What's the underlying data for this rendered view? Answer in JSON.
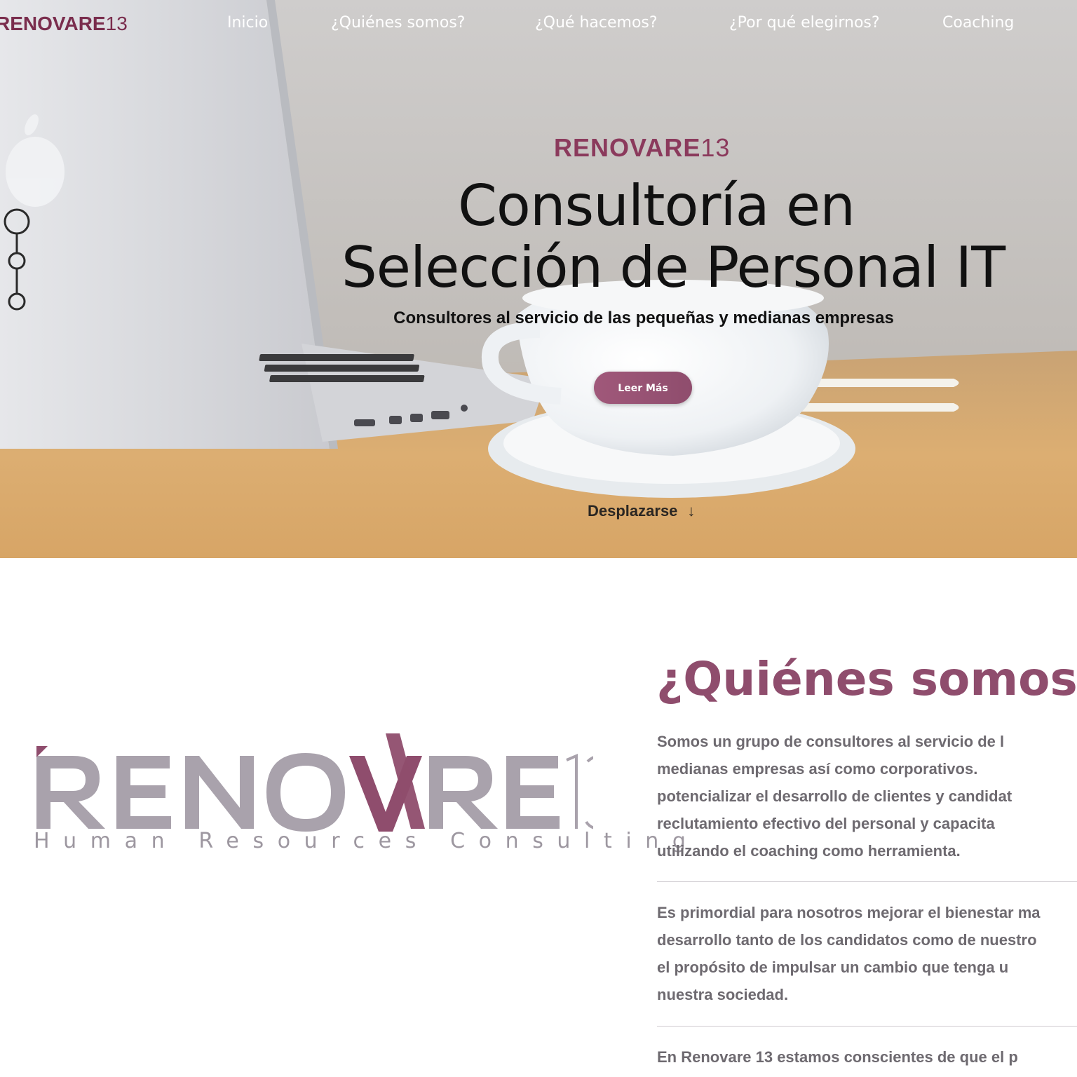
{
  "brand": {
    "word": "RENOVARE",
    "number": "13",
    "tagline": "Human Resources Consulting"
  },
  "nav": {
    "items": [
      {
        "label": "Inicio"
      },
      {
        "label": "¿Quiénes somos?"
      },
      {
        "label": "¿Qué hacemos?"
      },
      {
        "label": "¿Por qué elegirnos?"
      },
      {
        "label": "Coaching"
      }
    ]
  },
  "hero": {
    "title_line1": "Consultoría en",
    "title_line2": "Selección de Personal IT",
    "subtitle": "Consultores al servicio de las pequeñas y medianas empresas",
    "button_label": "Leer Más",
    "scroll_label": "Desplazarse",
    "scroll_arrow": "↓",
    "slide_count": 3,
    "active_slide": 1
  },
  "about": {
    "title": "¿Quiénes somos",
    "paragraph1_lines": [
      "Somos un grupo de consultores al servicio de l",
      "medianas empresas así como corporativos.",
      "potencializar el desarrollo de clientes y candidat",
      "reclutamiento efectivo del personal y capacita",
      "utilizando el coaching como herramienta."
    ],
    "paragraph2_lines": [
      "Es primordial para nosotros mejorar el bienestar ma",
      "desarrollo tanto de los candidatos como de nuestro",
      "el propósito de impulsar un cambio que tenga u",
      "nuestra sociedad."
    ],
    "paragraph3_lines": [
      "En Renovare 13 estamos conscientes de que el p"
    ]
  },
  "colors": {
    "brand_primary": "#8f4d6d",
    "brand_gray": "#a9a2ac",
    "body_text": "#6e6a70"
  },
  "icons": {
    "slide_dots": "slider-dots-icon",
    "scroll": "arrow-down-icon"
  }
}
